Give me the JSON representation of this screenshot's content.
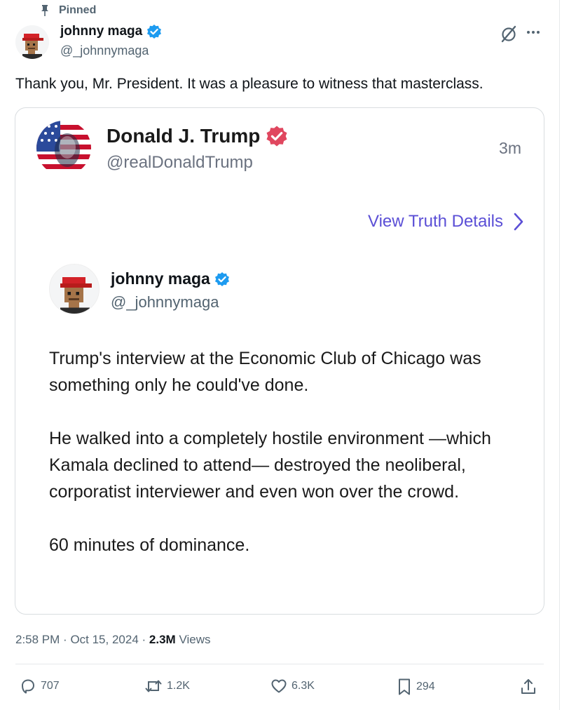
{
  "pinned_label": "Pinned",
  "author": {
    "name": "johnny maga",
    "handle": "@_johnnymaga"
  },
  "tweet_text": "Thank you, Mr. President. It was a pleasure to witness that masterclass.",
  "embed": {
    "name": "Donald J. Trump",
    "handle": "@realDonaldTrump",
    "time": "3m",
    "view_details_label": "View Truth Details",
    "quoted": {
      "name": "johnny maga",
      "handle": "@_johnnymaga",
      "paragraphs": [
        "Trump's interview at the Economic Club of Chicago was something only he could've done.",
        "He walked into a completely hostile environment —which Kamala declined to attend— destroyed the neoliberal, corporatist interviewer and even won over the crowd.",
        "60 minutes of dominance."
      ]
    }
  },
  "meta": {
    "time": "2:58 PM",
    "date": "Oct 15, 2024",
    "views_count": "2.3M",
    "views_label": "Views"
  },
  "actions": {
    "replies": "707",
    "reposts": "1.2K",
    "likes": "6.3K",
    "bookmarks": "294"
  },
  "colors": {
    "verified_blue": "#1d9bf0",
    "truth_badge": "#e0475f",
    "truth_link": "#5b4fd6",
    "muted": "#536471"
  },
  "icons": [
    "pin-icon",
    "verified-badge-icon",
    "grok-icon",
    "more-icon",
    "chevron-right-icon",
    "reply-icon",
    "repost-icon",
    "like-icon",
    "bookmark-icon",
    "share-icon"
  ]
}
